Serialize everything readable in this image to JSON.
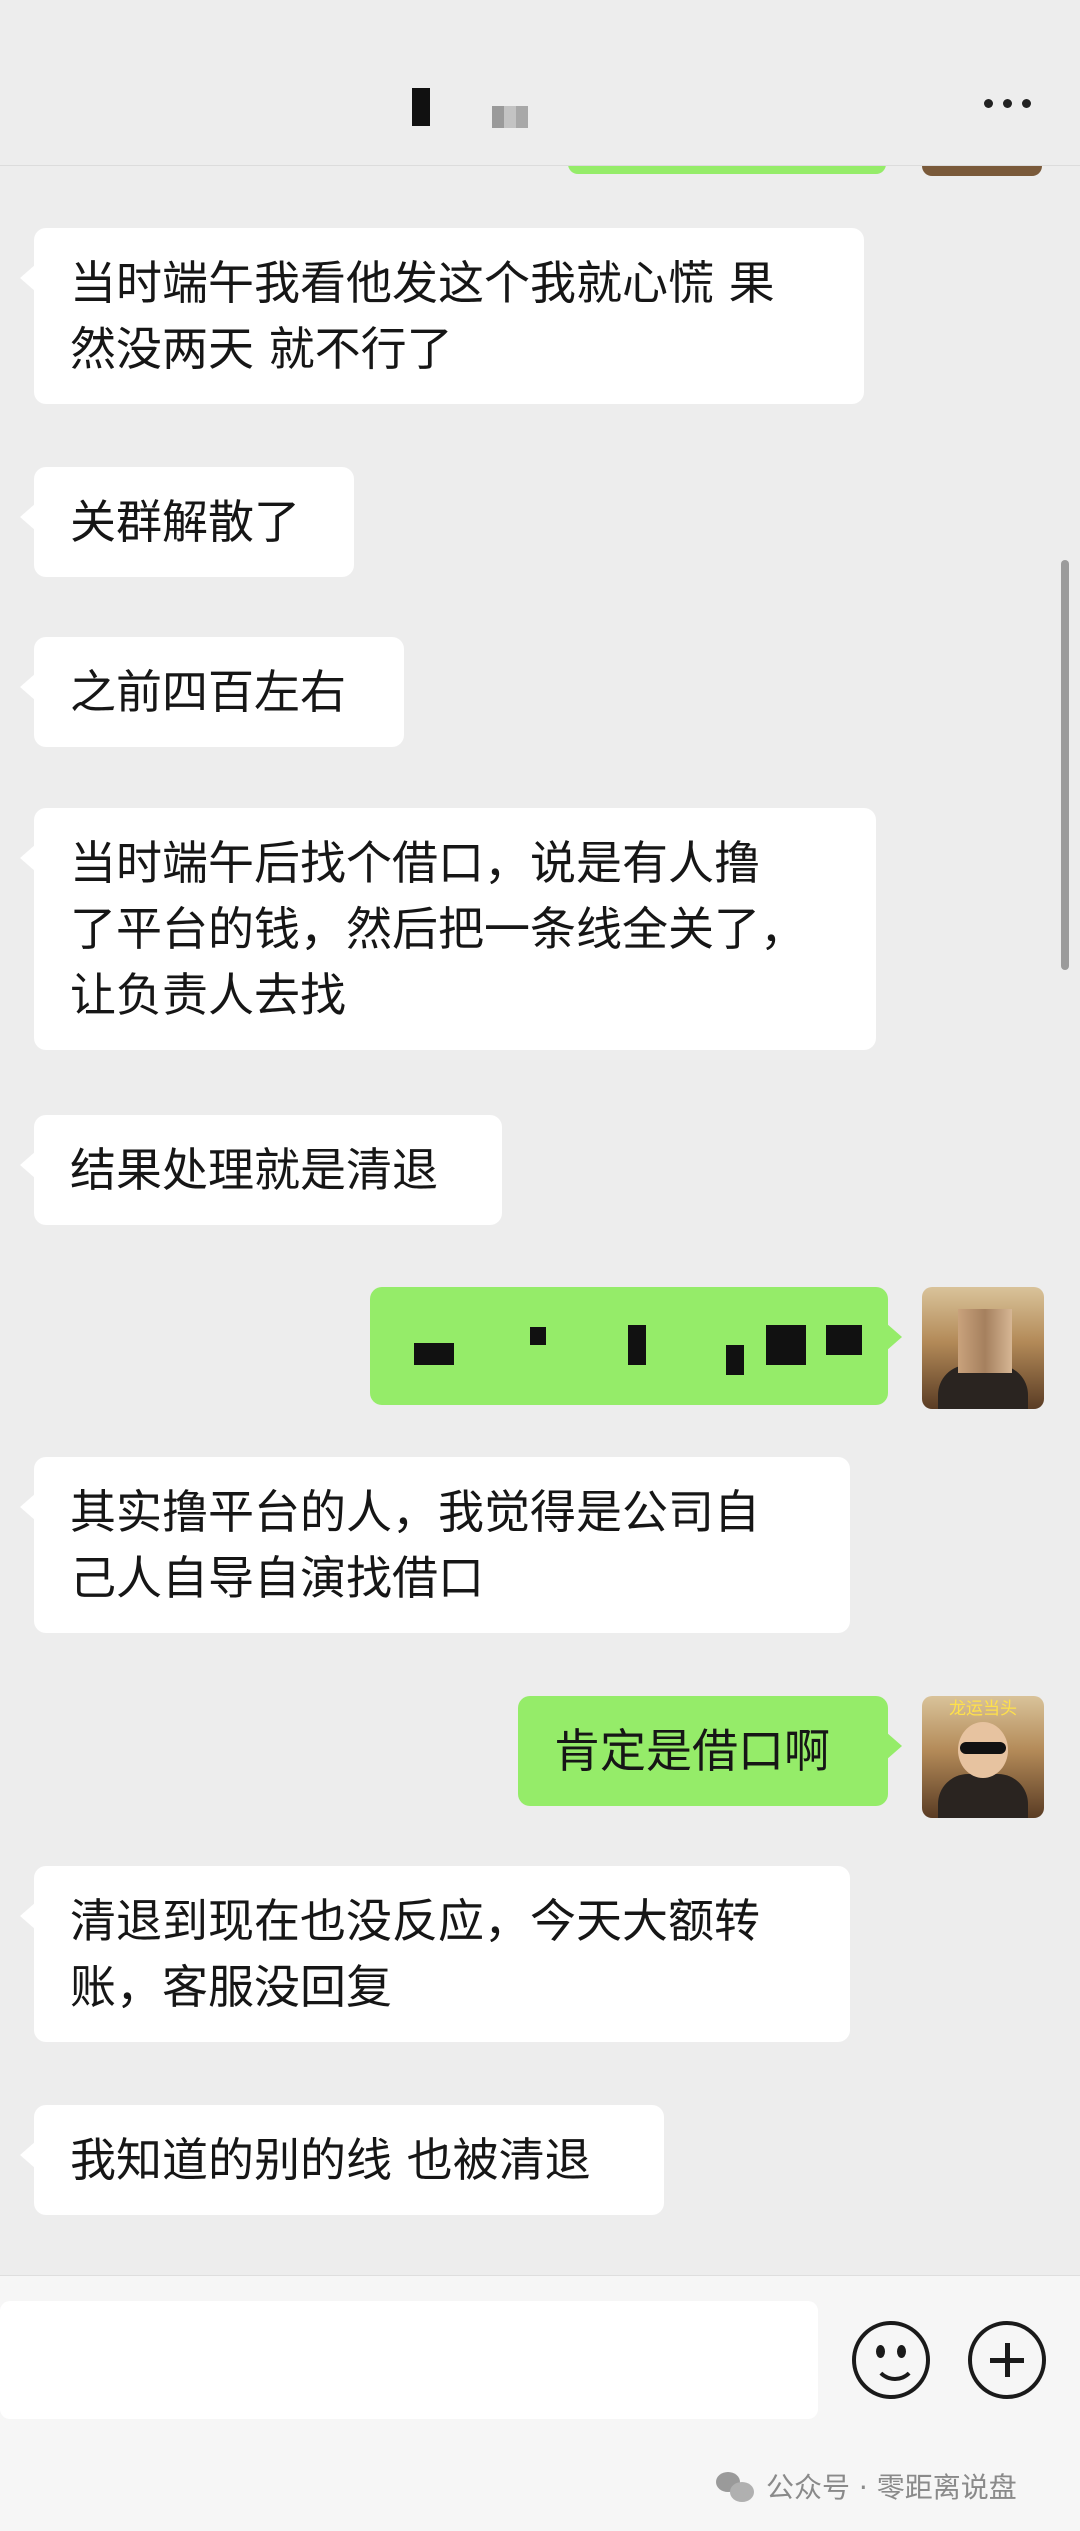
{
  "header": {
    "title": "",
    "more_label": "···"
  },
  "messages": [
    {
      "id": "m1",
      "side": "left",
      "text": "当时端午我看他发这个我就心慌 果\n然没两天 就不行了"
    },
    {
      "id": "m2",
      "side": "left",
      "text": "关群解散了"
    },
    {
      "id": "m3",
      "side": "left",
      "text": "之前四百左右"
    },
    {
      "id": "m4",
      "side": "left",
      "text": "当时端午后找个借口，说是有人撸\n了平台的钱，然后把一条线全关了，\n让负责人去找"
    },
    {
      "id": "m5",
      "side": "left",
      "text": "结果处理就是清退"
    },
    {
      "id": "m6",
      "side": "right",
      "text": "",
      "redacted": true
    },
    {
      "id": "m7",
      "side": "left",
      "text": "其实撸平台的人，我觉得是公司自\n己人自导自演找借口"
    },
    {
      "id": "m8",
      "side": "right",
      "text": "肯定是借口啊"
    },
    {
      "id": "m9",
      "side": "left",
      "text": "清退到现在也没反应，今天大额转\n账，客服没回复"
    },
    {
      "id": "m10",
      "side": "left",
      "text": "我知道的别的线 也被清退"
    }
  ],
  "avatar": {
    "tag_text": "龙运当头"
  },
  "input": {
    "value": "",
    "placeholder": ""
  },
  "icons": {
    "emoji": "emoji-icon",
    "plus": "plus-icon",
    "more": "more-icon"
  },
  "watermark": {
    "text": "公众号 · 零距离说盘"
  },
  "colors": {
    "background": "#ededed",
    "sent_bubble": "#95ec69",
    "received_bubble": "#ffffff"
  }
}
